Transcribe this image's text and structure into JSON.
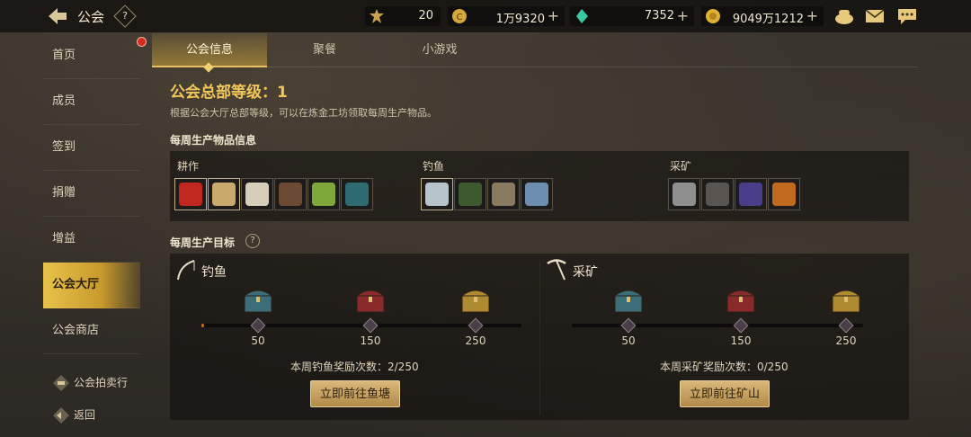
{
  "header": {
    "title": "公会",
    "help_glyph": "?",
    "resources": [
      {
        "name": "arena-token",
        "value": "20",
        "has_plus": false,
        "color": "#c9a24a"
      },
      {
        "name": "coin",
        "value": "1万9320",
        "has_plus": true,
        "color": "#d4a83a"
      },
      {
        "name": "gem",
        "value": "7352",
        "has_plus": true,
        "color": "#3ac8a0"
      },
      {
        "name": "gold",
        "value": "9049万1212",
        "has_plus": true,
        "color": "#e0b030"
      }
    ],
    "plus_glyph": "+",
    "icons": [
      "pot-icon",
      "mail-icon",
      "chat-icon"
    ]
  },
  "sidebar": {
    "items": [
      {
        "label": "首页",
        "active": false
      },
      {
        "label": "成员",
        "active": false
      },
      {
        "label": "签到",
        "active": false
      },
      {
        "label": "捐赠",
        "active": false
      },
      {
        "label": "增益",
        "active": false
      },
      {
        "label": "公会大厅",
        "active": true
      },
      {
        "label": "公会商店",
        "active": false
      }
    ],
    "auction_label": "公会拍卖行",
    "back_label": "返回"
  },
  "tabs": [
    {
      "label": "公会信息",
      "active": true
    },
    {
      "label": "聚餐",
      "active": false
    },
    {
      "label": "小游戏",
      "active": false
    }
  ],
  "main": {
    "hq_level_title": "公会总部等级：1",
    "hq_desc": "根据公会大厅总部等级，可以在炼金工坊领取每周生产物品。",
    "weekly_items_title": "每周生产物品信息",
    "categories": [
      {
        "label": "耕作",
        "items": [
          "cherry",
          "wood-plank",
          "grain-pile",
          "root",
          "seed-pod",
          "feather-leaf"
        ]
      },
      {
        "label": "钓鱼",
        "items": [
          "fish",
          "seaweed",
          "shell",
          "pearl"
        ]
      },
      {
        "label": "采矿",
        "items": [
          "stone",
          "iron-ore",
          "crystal-ore",
          "amber"
        ]
      }
    ],
    "item_colors": {
      "cherry": "#c0271e",
      "wood-plank": "#c9a86b",
      "grain-pile": "#d8cdb8",
      "root": "#6b4a34",
      "seed-pod": "#7fa83a",
      "feather-leaf": "#2d6a72",
      "fish": "#b8c4cc",
      "seaweed": "#3c5a2e",
      "shell": "#8a7a62",
      "pearl": "#6d8db0",
      "stone": "#8f8f8f",
      "iron-ore": "#5a5550",
      "crystal-ore": "#4a3d8a",
      "amber": "#c06a1e"
    },
    "weekly_goal_title": "每周生产目标",
    "goal_help_glyph": "?",
    "goals": [
      {
        "label": "钓鱼",
        "thresholds": [
          "50",
          "150",
          "250"
        ],
        "progress": 2,
        "max": 250,
        "count_text": "本周钓鱼奖励次数：2/250",
        "button": "立即前往鱼塘"
      },
      {
        "label": "采矿",
        "thresholds": [
          "50",
          "150",
          "250"
        ],
        "progress": 0,
        "max": 250,
        "count_text": "本周采矿奖励次数：0/250",
        "button": "立即前往矿山"
      }
    ],
    "chest_colors": [
      "#3c6e7a",
      "#8a2a2a",
      "#b08a30"
    ]
  }
}
